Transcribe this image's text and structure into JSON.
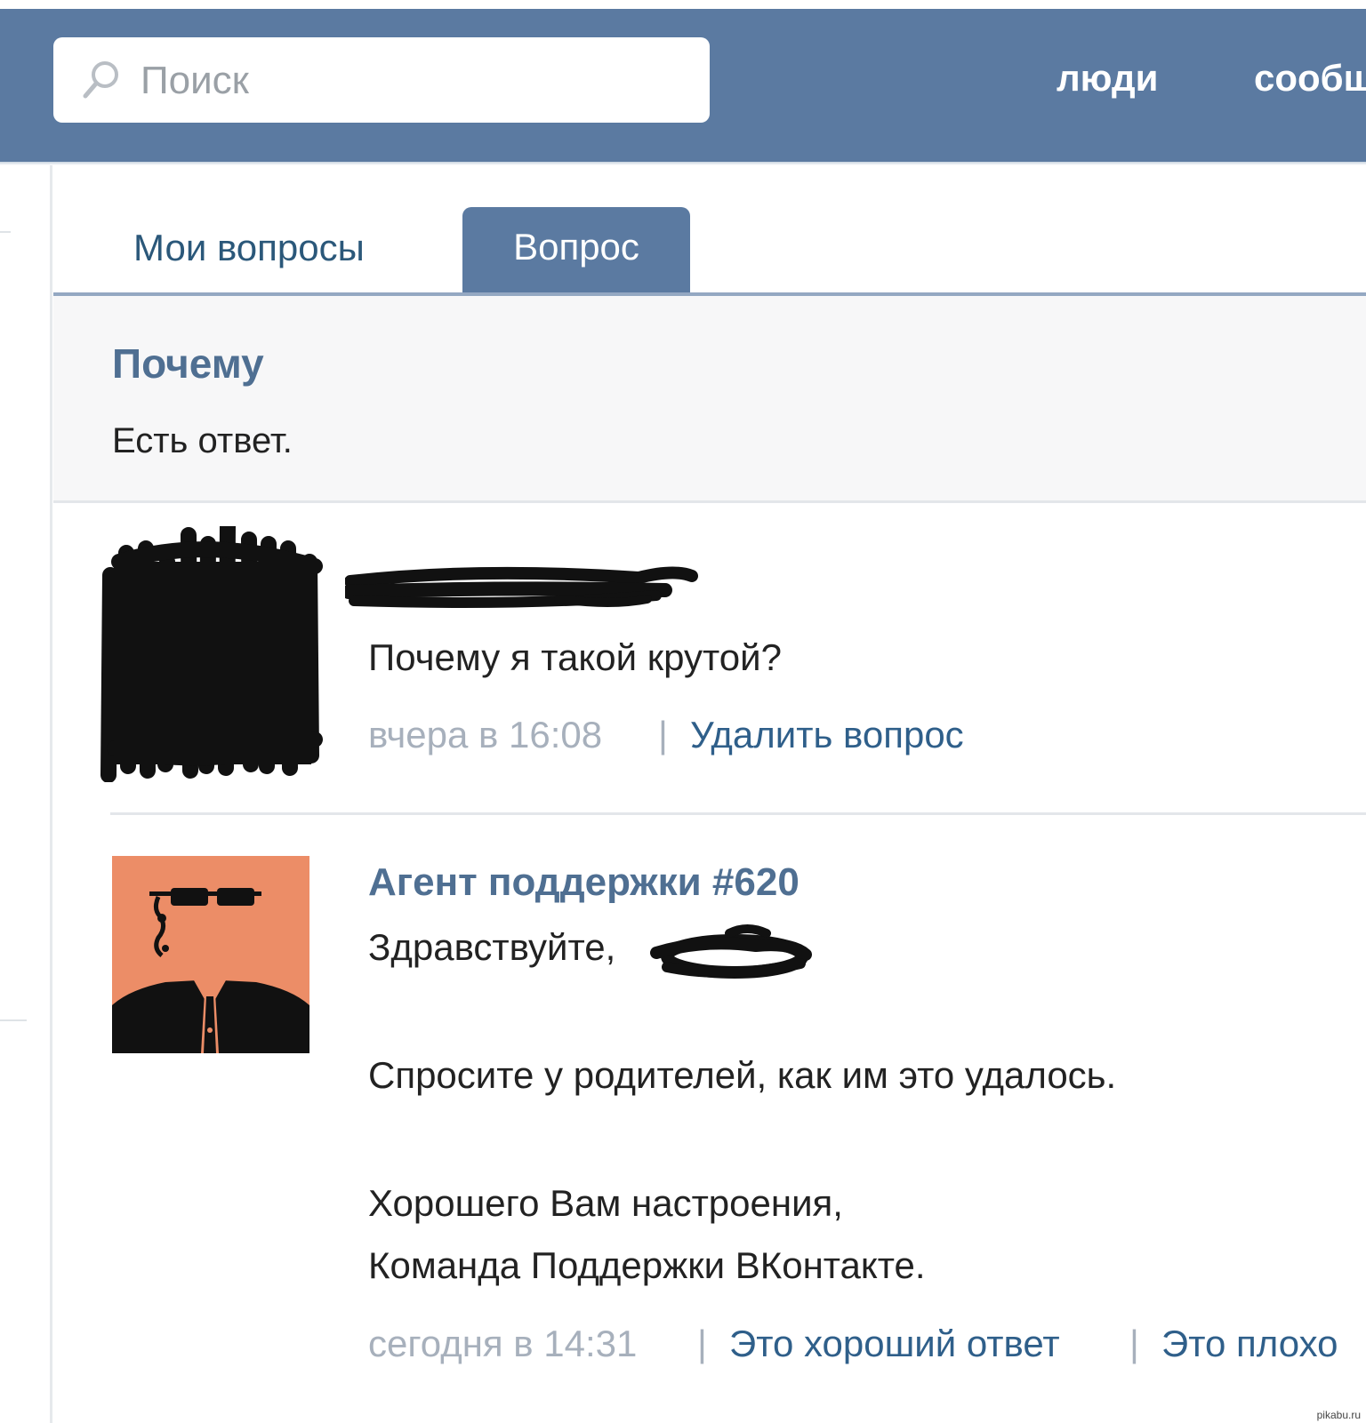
{
  "header": {
    "search": {
      "placeholder": "Поиск",
      "value": ""
    },
    "nav": [
      "люди",
      "сообщ"
    ],
    "colors": {
      "bar": "#5b7aa1",
      "text": "#ffffff"
    }
  },
  "tabs": [
    {
      "label": "Мои вопросы",
      "active": false
    },
    {
      "label": "Вопрос",
      "active": true
    }
  ],
  "question": {
    "title": "Почему",
    "status": "Есть ответ."
  },
  "messages": [
    {
      "author_redacted": true,
      "text": "Почему я такой крутой?",
      "time": "вчера в 16:08",
      "sep": "|",
      "actions": [
        "Удалить вопрос"
      ]
    },
    {
      "author": "Агент поддержки #620",
      "greeting": "Здравствуйте,",
      "body": "Спросите у родителей, как им это удалось.",
      "closing1": "Хорошего Вам настроения,",
      "closing2": "Команда Поддержки ВКонтакте.",
      "time": "сегодня в 14:31",
      "sep": "|",
      "actions": [
        "Это хороший ответ",
        "Это плохо"
      ]
    }
  ],
  "watermark": "pikabu.ru",
  "colors": {
    "link": "#2f5f8a",
    "title": "#4f6f92",
    "meta": "#a7b0bc",
    "agent_avatar_bg": "#ec8d67"
  }
}
